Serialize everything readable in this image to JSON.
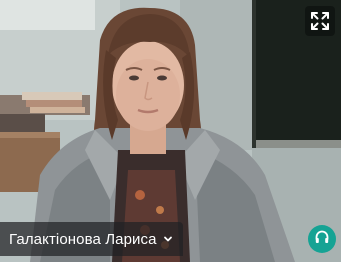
{
  "participant": {
    "name": "Галактіонова Лариса"
  },
  "controls": {
    "expand_icon": "expand-arrows-icon",
    "name_menu_icon": "chevron-down-icon",
    "audio_icon": "headphones-icon"
  },
  "colors": {
    "audio_badge": "#16a394",
    "name_pill_bg": "#202124"
  }
}
